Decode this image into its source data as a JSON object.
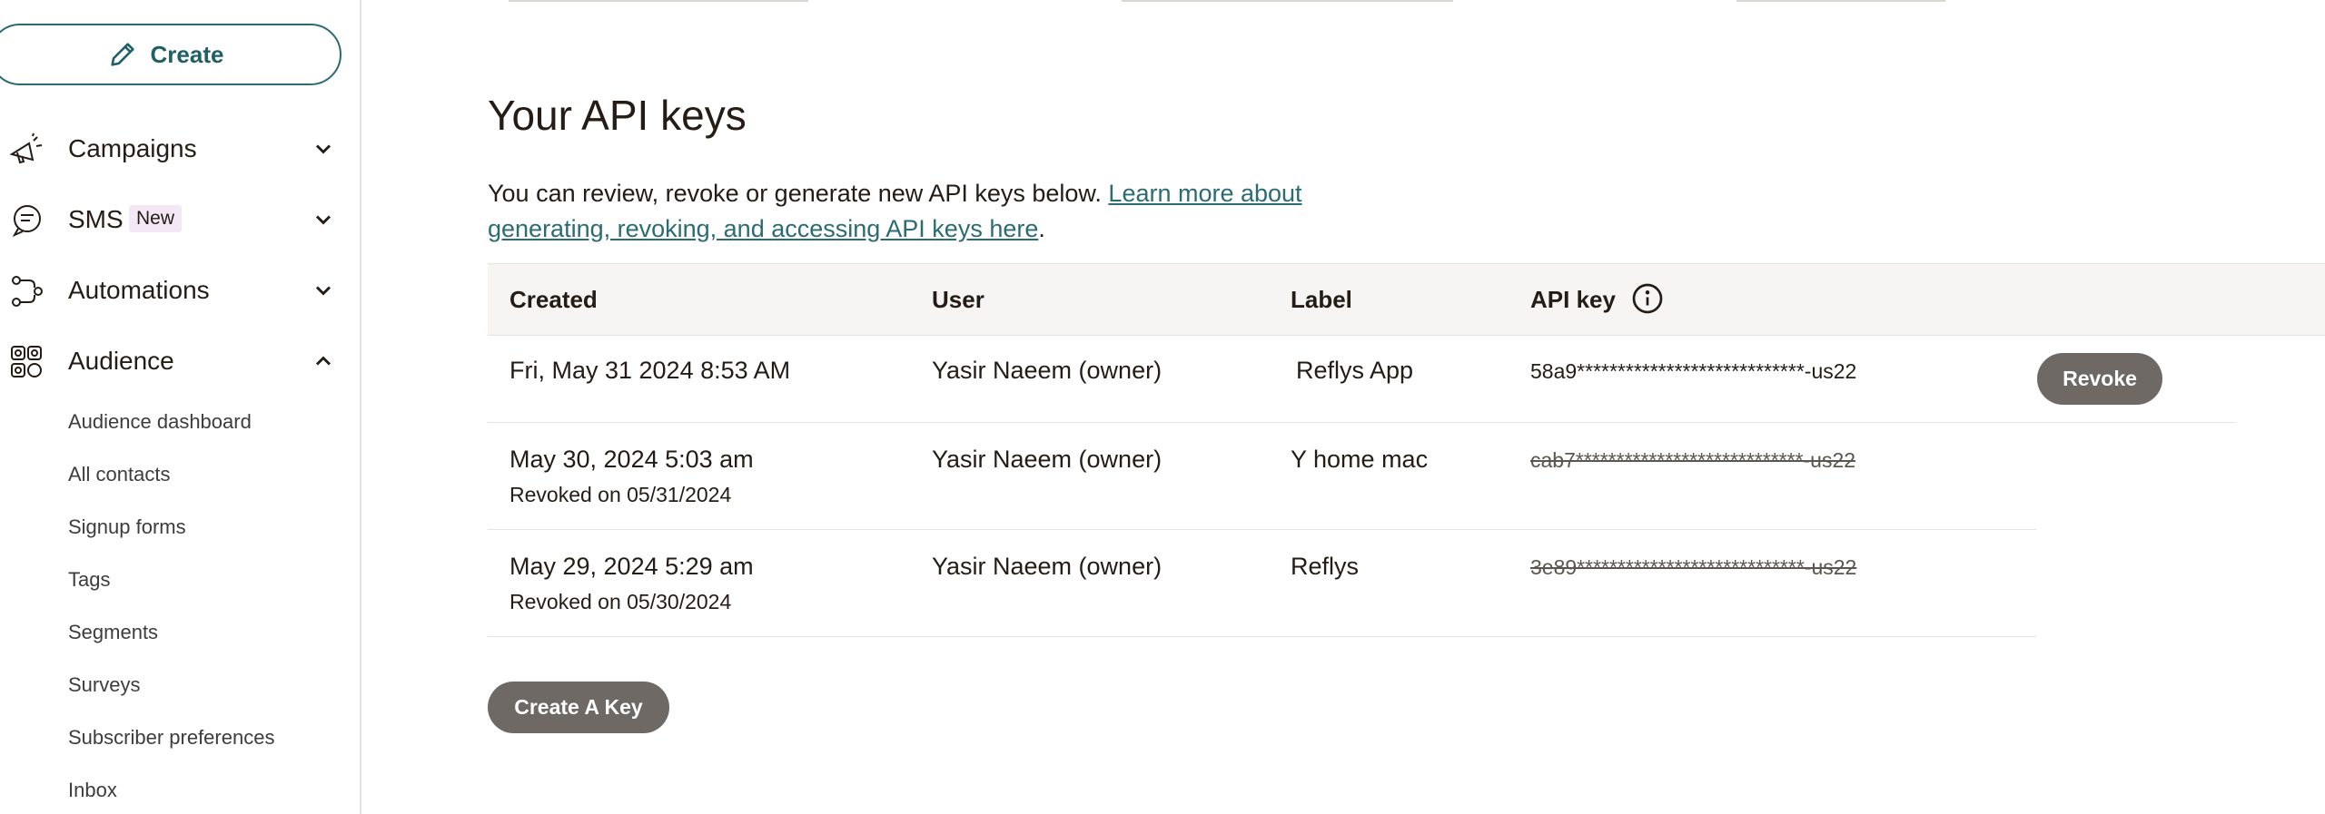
{
  "sidebar": {
    "create_label": "Create",
    "items": [
      {
        "label": "Campaigns",
        "icon": "megaphone-icon",
        "expanded": false
      },
      {
        "label": "SMS",
        "badge": "New",
        "icon": "chat-bubble-icon",
        "expanded": false
      },
      {
        "label": "Automations",
        "icon": "workflow-icon",
        "expanded": false
      },
      {
        "label": "Audience",
        "icon": "audience-icon",
        "expanded": true
      }
    ],
    "audience_subitems": [
      "Audience dashboard",
      "All contacts",
      "Signup forms",
      "Tags",
      "Segments",
      "Surveys",
      "Subscriber preferences",
      "Inbox"
    ]
  },
  "main": {
    "title": "Your API keys",
    "description": "You can review, revoke or generate new API keys below. ",
    "link_text": "Learn more about generating, revoking, and accessing API keys here",
    "description_end": ".",
    "table": {
      "headers": [
        "Created",
        "User",
        "Label",
        "API key"
      ],
      "rows": [
        {
          "created": "Fri, May 31 2024 8:53 AM",
          "revoked_on": "",
          "user": "Yasir Naeem (owner)",
          "label": "Reflys App",
          "key": "58a9****************************-us22",
          "revoked": false,
          "action": "Revoke"
        },
        {
          "created": "May 30, 2024 5:03 am",
          "revoked_on": "Revoked on 05/31/2024",
          "user": "Yasir Naeem (owner)",
          "label": "Y home mac",
          "key": "cab7****************************-us22",
          "revoked": true
        },
        {
          "created": "May 29, 2024 5:29 am",
          "revoked_on": "Revoked on 05/30/2024",
          "user": "Yasir Naeem (owner)",
          "label": "Reflys",
          "key": "3e89****************************-us22",
          "revoked": true
        }
      ]
    },
    "create_key_label": "Create A Key"
  },
  "colors": {
    "accent": "#2b6c73",
    "button_dark": "#6e6965",
    "header_bg": "#f6f5f3",
    "badge_bg": "#f4e8f6"
  }
}
